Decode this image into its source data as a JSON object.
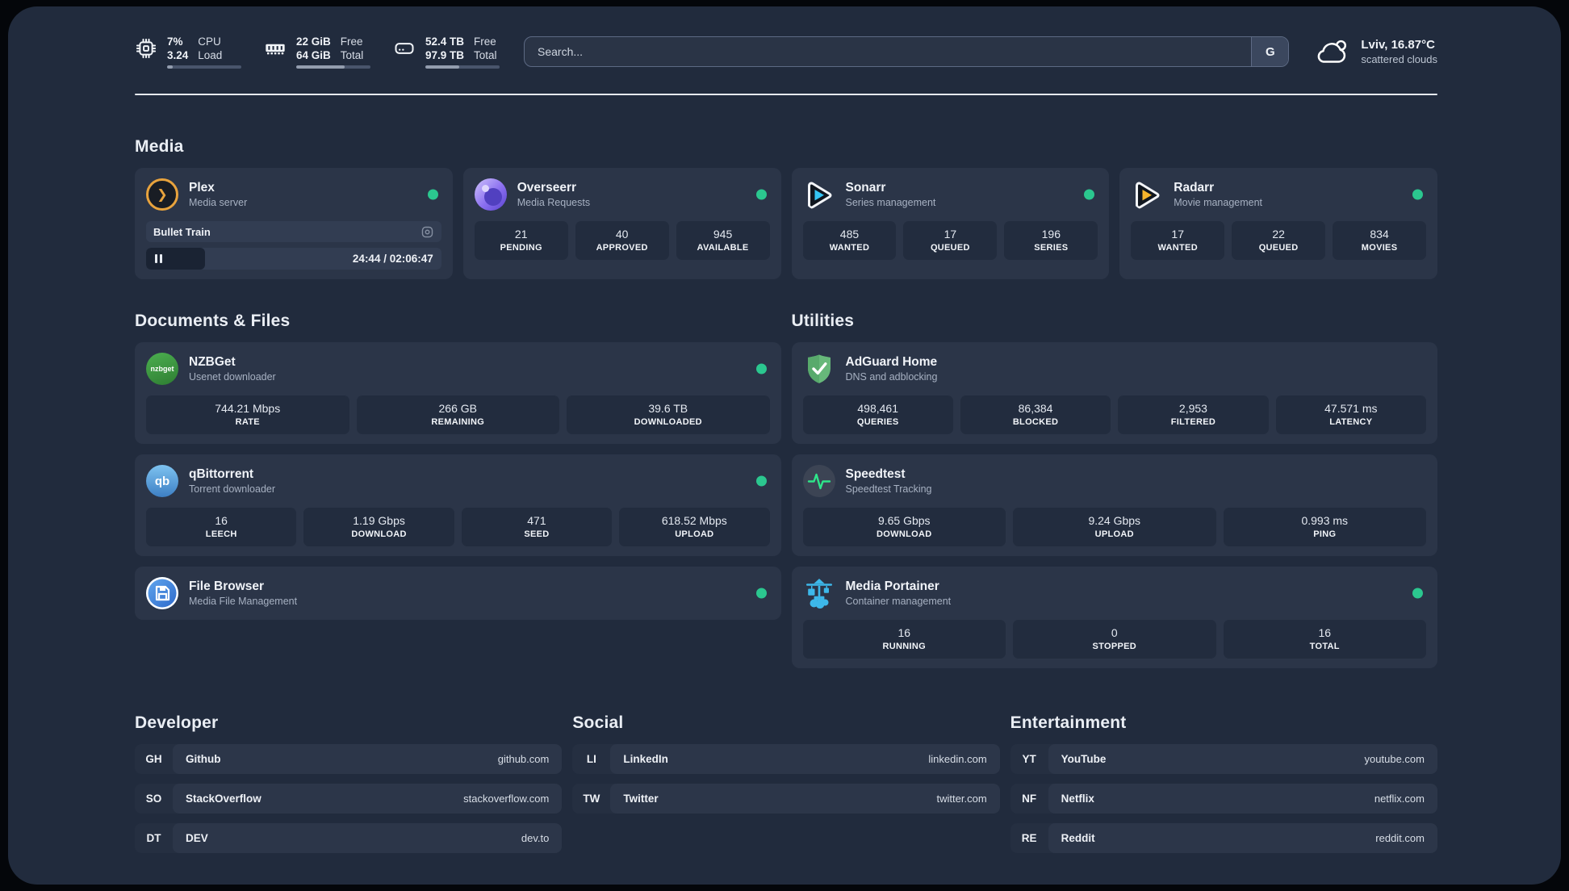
{
  "colors": {
    "status_green": "#2bc78f",
    "page_bg": "#212b3d",
    "card_bg": "#2b3548",
    "plex_amber": "#e8a33d",
    "sonarr_blue": "#35c5f4",
    "radarr_amber": "#f7b52c",
    "nzbget_green": "#4caf50",
    "qbittorrent_blue": "#3d7fc4",
    "filebrowser_blue": "#2b66c9",
    "adguard_green": "#67b87a",
    "speedtest_green": "#2ee58a",
    "portainer_blue": "#3db8ea"
  },
  "header": {
    "metrics": [
      {
        "id": "cpu",
        "values": [
          "7%",
          "3.24"
        ],
        "labels": [
          "CPU",
          "Load"
        ],
        "progress_pct": 8
      },
      {
        "id": "memory",
        "values": [
          "22 GiB",
          "64 GiB"
        ],
        "labels": [
          "Free",
          "Total"
        ],
        "progress_pct": 65
      },
      {
        "id": "disk",
        "values": [
          "52.4 TB",
          "97.9 TB"
        ],
        "labels": [
          "Free",
          "Total"
        ],
        "progress_pct": 46
      }
    ],
    "search": {
      "placeholder": "Search...",
      "engine_button": "G"
    },
    "weather": {
      "location_temp": "Lviv, 16.87°C",
      "condition": "scattered clouds"
    }
  },
  "sections": {
    "media": "Media",
    "documents": "Documents & Files",
    "utilities": "Utilities",
    "developer": "Developer",
    "social": "Social",
    "entertainment": "Entertainment"
  },
  "services": {
    "plex": {
      "title": "Plex",
      "subtitle": "Media server",
      "logo_text": "❯",
      "now_playing": "Bullet Train",
      "time": "24:44 / 02:06:47",
      "progress_pct": 20
    },
    "overseerr": {
      "title": "Overseerr",
      "subtitle": "Media Requests",
      "stats": [
        {
          "value": "21",
          "label": "PENDING"
        },
        {
          "value": "40",
          "label": "APPROVED"
        },
        {
          "value": "945",
          "label": "AVAILABLE"
        }
      ]
    },
    "sonarr": {
      "title": "Sonarr",
      "subtitle": "Series management",
      "stats": [
        {
          "value": "485",
          "label": "WANTED"
        },
        {
          "value": "17",
          "label": "QUEUED"
        },
        {
          "value": "196",
          "label": "SERIES"
        }
      ]
    },
    "radarr": {
      "title": "Radarr",
      "subtitle": "Movie management",
      "stats": [
        {
          "value": "17",
          "label": "WANTED"
        },
        {
          "value": "22",
          "label": "QUEUED"
        },
        {
          "value": "834",
          "label": "MOVIES"
        }
      ]
    },
    "nzbget": {
      "title": "NZBGet",
      "subtitle": "Usenet downloader",
      "logo_text": "nzbget",
      "stats": [
        {
          "value": "744.21 Mbps",
          "label": "RATE"
        },
        {
          "value": "266 GB",
          "label": "REMAINING"
        },
        {
          "value": "39.6 TB",
          "label": "DOWNLOADED"
        }
      ]
    },
    "qbittorrent": {
      "title": "qBittorrent",
      "subtitle": "Torrent downloader",
      "logo_text": "qb",
      "stats": [
        {
          "value": "16",
          "label": "LEECH"
        },
        {
          "value": "1.19 Gbps",
          "label": "DOWNLOAD"
        },
        {
          "value": "471",
          "label": "SEED"
        },
        {
          "value": "618.52 Mbps",
          "label": "UPLOAD"
        }
      ]
    },
    "filebrowser": {
      "title": "File Browser",
      "subtitle": "Media File Management"
    },
    "adguard": {
      "title": "AdGuard Home",
      "subtitle": "DNS and adblocking",
      "stats": [
        {
          "value": "498,461",
          "label": "QUERIES"
        },
        {
          "value": "86,384",
          "label": "BLOCKED"
        },
        {
          "value": "2,953",
          "label": "FILTERED"
        },
        {
          "value": "47.571 ms",
          "label": "LATENCY"
        }
      ]
    },
    "speedtest": {
      "title": "Speedtest",
      "subtitle": "Speedtest Tracking",
      "stats": [
        {
          "value": "9.65 Gbps",
          "label": "DOWNLOAD"
        },
        {
          "value": "9.24 Gbps",
          "label": "UPLOAD"
        },
        {
          "value": "0.993 ms",
          "label": "PING"
        }
      ]
    },
    "portainer": {
      "title": "Media Portainer",
      "subtitle": "Container management",
      "stats": [
        {
          "value": "16",
          "label": "RUNNING"
        },
        {
          "value": "0",
          "label": "STOPPED"
        },
        {
          "value": "16",
          "label": "TOTAL"
        }
      ]
    }
  },
  "links": {
    "developer": [
      {
        "badge": "GH",
        "name": "Github",
        "url": "github.com"
      },
      {
        "badge": "SO",
        "name": "StackOverflow",
        "url": "stackoverflow.com"
      },
      {
        "badge": "DT",
        "name": "DEV",
        "url": "dev.to"
      }
    ],
    "social": [
      {
        "badge": "LI",
        "name": "LinkedIn",
        "url": "linkedin.com"
      },
      {
        "badge": "TW",
        "name": "Twitter",
        "url": "twitter.com"
      }
    ],
    "entertainment": [
      {
        "badge": "YT",
        "name": "YouTube",
        "url": "youtube.com"
      },
      {
        "badge": "NF",
        "name": "Netflix",
        "url": "netflix.com"
      },
      {
        "badge": "RE",
        "name": "Reddit",
        "url": "reddit.com"
      }
    ]
  }
}
